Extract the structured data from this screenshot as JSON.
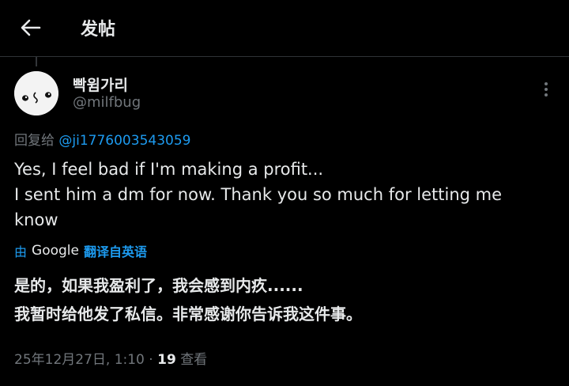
{
  "header": {
    "title": "发帖"
  },
  "post": {
    "display_name": "빡윔가리",
    "handle": "@milfbug",
    "reply_prefix": "回复给",
    "reply_to": "@ji1776003543059",
    "text_lines": [
      "Yes, I feel bad if I'm making a profit...",
      "I sent him a dm for now. Thank you so much for letting me",
      "know"
    ],
    "translate": {
      "by": "由",
      "provider": "Google",
      "action": "翻译自英语"
    },
    "translated_lines": [
      "是的，如果我盈利了，我会感到内疚......",
      "我暂时给他发了私信。非常感谢你告诉我这件事。"
    ],
    "meta": {
      "timestamp": "25年12月27日, 1:10",
      "separator": " · ",
      "views": "19",
      "views_label": "查看"
    }
  },
  "colors": {
    "background": "#000000",
    "text": "#e7e9ea",
    "muted": "#71767b",
    "accent": "#1d9bf0",
    "border": "#2f3336"
  },
  "icons": {
    "back": "arrow-left-icon",
    "more": "more-vertical-icon"
  }
}
